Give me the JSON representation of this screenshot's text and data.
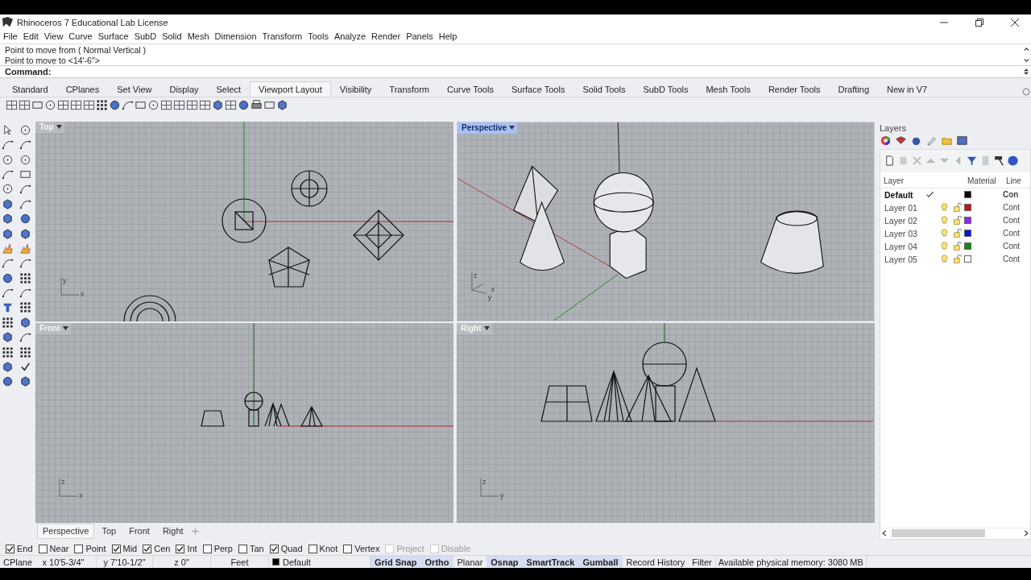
{
  "window": {
    "title": "Rhinoceros 7 Educational Lab License"
  },
  "menu": [
    "File",
    "Edit",
    "View",
    "Curve",
    "Surface",
    "SubD",
    "Solid",
    "Mesh",
    "Dimension",
    "Transform",
    "Tools",
    "Analyze",
    "Render",
    "Panels",
    "Help"
  ],
  "command_history": [
    "Point to move from ( Normal  Vertical )",
    "Point to move to <14'-6\">"
  ],
  "command_prompt": "Command:",
  "toolbar_tabs": [
    {
      "label": "Standard",
      "selected": false
    },
    {
      "label": "CPlanes",
      "selected": false
    },
    {
      "label": "Set View",
      "selected": false
    },
    {
      "label": "Display",
      "selected": false
    },
    {
      "label": "Select",
      "selected": false
    },
    {
      "label": "Viewport Layout",
      "selected": true
    },
    {
      "label": "Visibility",
      "selected": false
    },
    {
      "label": "Transform",
      "selected": false
    },
    {
      "label": "Curve Tools",
      "selected": false
    },
    {
      "label": "Surface Tools",
      "selected": false
    },
    {
      "label": "Solid Tools",
      "selected": false
    },
    {
      "label": "SubD Tools",
      "selected": false
    },
    {
      "label": "Mesh Tools",
      "selected": false
    },
    {
      "label": "Render Tools",
      "selected": false
    },
    {
      "label": "Drafting",
      "selected": false
    },
    {
      "label": "New in V7",
      "selected": false
    }
  ],
  "viewports": [
    {
      "title": "Top",
      "selected": false,
      "axis_labels": [
        "y",
        "x"
      ]
    },
    {
      "title": "Perspective",
      "selected": true,
      "axis_labels": [
        "z",
        "x",
        "y"
      ]
    },
    {
      "title": "Front",
      "selected": false,
      "axis_labels": [
        "z",
        "x"
      ]
    },
    {
      "title": "Right",
      "selected": false,
      "axis_labels": [
        "z",
        "y"
      ]
    }
  ],
  "layers_panel": {
    "title": "Layers",
    "columns": [
      "Layer",
      "Material",
      "Line"
    ],
    "layers": [
      {
        "name": "Default",
        "current": true,
        "color": "#000000",
        "linetype": "Con"
      },
      {
        "name": "Layer 01",
        "current": false,
        "color": "#d01010",
        "linetype": "Cont"
      },
      {
        "name": "Layer 02",
        "current": false,
        "color": "#8a2be2",
        "linetype": "Cont"
      },
      {
        "name": "Layer 03",
        "current": false,
        "color": "#0a14e0",
        "linetype": "Cont"
      },
      {
        "name": "Layer 04",
        "current": false,
        "color": "#108a10",
        "linetype": "Cont"
      },
      {
        "name": "Layer 05",
        "current": false,
        "color": "#ffffff",
        "linetype": "Cont"
      }
    ]
  },
  "viewport_tabs": [
    {
      "label": "Perspective",
      "selected": true
    },
    {
      "label": "Top",
      "selected": false
    },
    {
      "label": "Front",
      "selected": false
    },
    {
      "label": "Right",
      "selected": false
    }
  ],
  "osnaps": [
    {
      "label": "End",
      "checked": true,
      "disabled": false
    },
    {
      "label": "Near",
      "checked": false,
      "disabled": false
    },
    {
      "label": "Point",
      "checked": false,
      "disabled": false
    },
    {
      "label": "Mid",
      "checked": true,
      "disabled": false
    },
    {
      "label": "Cen",
      "checked": true,
      "disabled": false
    },
    {
      "label": "Int",
      "checked": true,
      "disabled": false
    },
    {
      "label": "Perp",
      "checked": false,
      "disabled": false
    },
    {
      "label": "Tan",
      "checked": false,
      "disabled": false
    },
    {
      "label": "Quad",
      "checked": true,
      "disabled": false
    },
    {
      "label": "Knot",
      "checked": false,
      "disabled": false
    },
    {
      "label": "Vertex",
      "checked": false,
      "disabled": false
    },
    {
      "label": "Project",
      "checked": false,
      "disabled": true
    },
    {
      "label": "Disable",
      "checked": false,
      "disabled": true
    }
  ],
  "status_bar": {
    "cplane": "CPlane",
    "x": "x 10'5-3/4\"",
    "y": "y 7'10-1/2\"",
    "z": "z 0\"",
    "units": "Feet",
    "layer": {
      "name": "Default",
      "color": "#000000"
    },
    "toggles": [
      {
        "label": "Grid Snap",
        "on": true
      },
      {
        "label": "Ortho",
        "on": true
      },
      {
        "label": "Planar",
        "on": false
      },
      {
        "label": "Osnap",
        "on": true
      },
      {
        "label": "SmartTrack",
        "on": true
      },
      {
        "label": "Gumball",
        "on": true
      },
      {
        "label": "Record History",
        "on": false
      }
    ],
    "filter": "Filter",
    "memory": "Available physical memory: 3080 MB"
  }
}
